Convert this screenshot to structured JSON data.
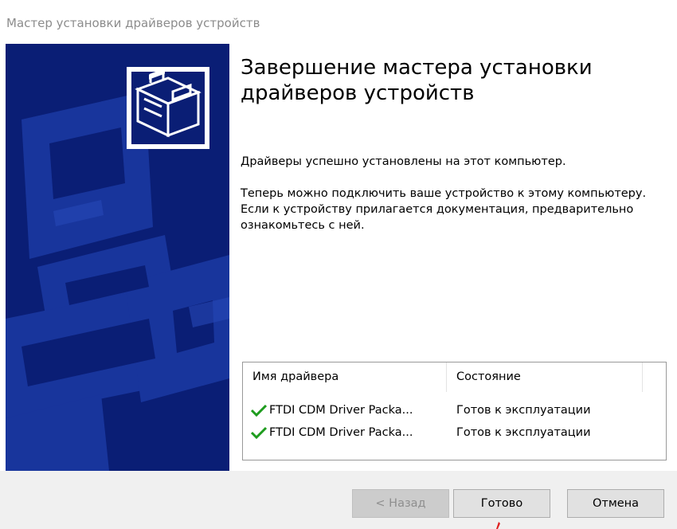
{
  "window": {
    "title": "Мастер установки драйверов устройств"
  },
  "colors": {
    "banner": "#0a1e75",
    "check": "#1e9c1e"
  },
  "content": {
    "heading": "Завершение мастера установки драйверов устройств",
    "paragraph1": "Драйверы успешно установлены на этот компьютер.",
    "paragraph2": "Теперь можно подключить ваше устройство к этому компьютеру. Если к устройству прилагается документация, предварительно ознакомьтесь с ней."
  },
  "driver_list": {
    "columns": [
      "Имя драйвера",
      "Состояние"
    ],
    "rows": [
      {
        "icon": "check-icon",
        "name": "FTDI CDM Driver Packa...",
        "state": "Готов к эксплуатации"
      },
      {
        "icon": "check-icon",
        "name": "FTDI CDM Driver Packa...",
        "state": "Готов к эксплуатации"
      }
    ]
  },
  "buttons": {
    "back": "< Назад",
    "finish": "Готово",
    "cancel": "Отмена"
  }
}
